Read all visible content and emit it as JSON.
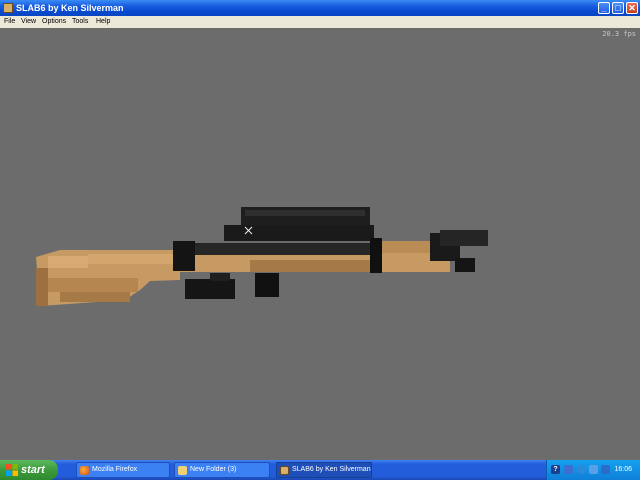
{
  "window": {
    "title": "SLAB6 by Ken Silverman",
    "icon": "slab6-app-icon",
    "controls": {
      "minimize": "_",
      "maximize": "□",
      "close": "✕"
    }
  },
  "menu": {
    "items": [
      {
        "label": "File"
      },
      {
        "label": "View"
      },
      {
        "label": "Options"
      },
      {
        "label": "Tools"
      },
      {
        "label": "Help"
      }
    ]
  },
  "viewport": {
    "fps": "20.3 fps",
    "background_color": "#6c6c6c",
    "model_colors": {
      "wood": "#c89a63",
      "metal": "#1e1e1e"
    }
  },
  "taskbar": {
    "start_label": "start",
    "tasks": [
      {
        "label": "Mozilla Firefox",
        "icon": "firefox-icon",
        "active": false
      },
      {
        "label": "New Folder (3)",
        "icon": "folder-icon",
        "active": false
      },
      {
        "label": "SLAB6 by Ken Silverman",
        "icon": "slab6-app-icon",
        "active": true
      }
    ],
    "clock": "16:06"
  }
}
